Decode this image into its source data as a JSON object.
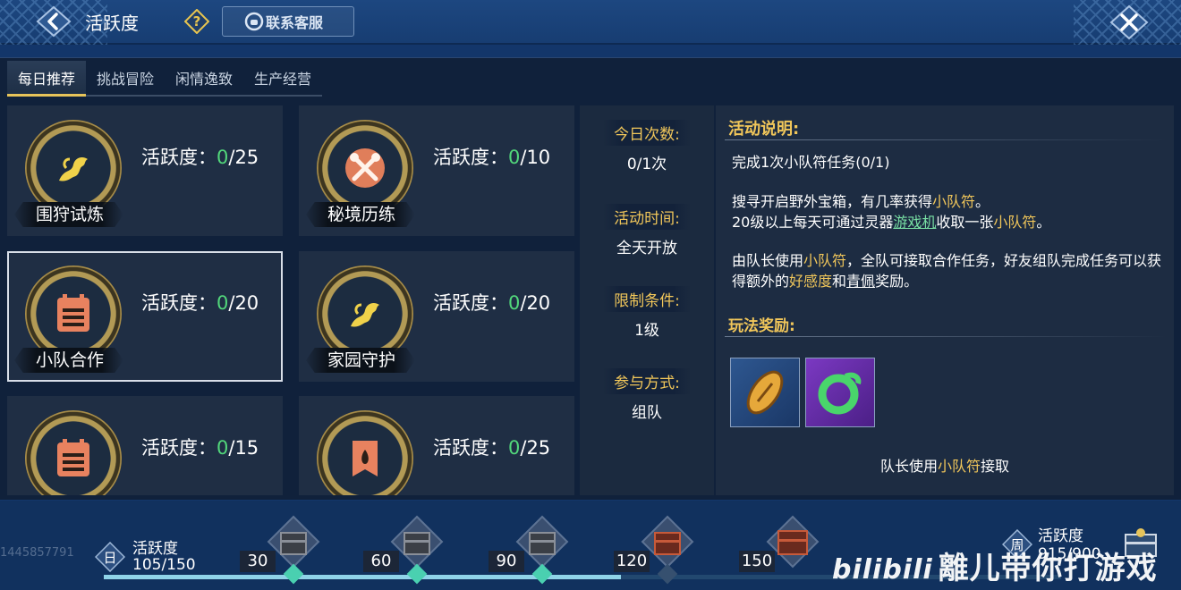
{
  "header": {
    "title": "活跃度",
    "customer_service": "联系客服"
  },
  "tabs": [
    {
      "label": "每日推荐",
      "active": true
    },
    {
      "label": "挑战冒险",
      "active": false
    },
    {
      "label": "闲情逸致",
      "active": false
    },
    {
      "label": "生产经营",
      "active": false
    }
  ],
  "activity_label": "活跃度：",
  "cards": [
    {
      "name": "围狩试炼",
      "current": "0",
      "max": "/25",
      "icon": "creature-icon"
    },
    {
      "name": "秘境历练",
      "current": "0",
      "max": "/10",
      "icon": "crossed-tools-icon"
    },
    {
      "name": "小队合作",
      "current": "0",
      "max": "/20",
      "icon": "calendar-icon"
    },
    {
      "name": "家园守护",
      "current": "0",
      "max": "/20",
      "icon": "creature-icon"
    },
    {
      "name": "",
      "current": "0",
      "max": "/15",
      "icon": "calendar-icon"
    },
    {
      "name": "",
      "current": "0",
      "max": "/25",
      "icon": "banner-icon"
    }
  ],
  "info": {
    "today_count": {
      "label": "今日次数:",
      "value": "0/1次"
    },
    "activity_time": {
      "label": "活动时间:",
      "value": "全天开放"
    },
    "restriction": {
      "label": "限制条件:",
      "value": "1级"
    },
    "participation": {
      "label": "参与方式:",
      "value": "组队"
    }
  },
  "description": {
    "title": "活动说明:",
    "task": {
      "prefix": "完成1次",
      "highlight": "小队符任务",
      "suffix": "(0/1)"
    },
    "p1": {
      "a": "搜寻开启野外宝箱，有几率获得",
      "b": "小队符",
      "c": "。"
    },
    "p2": {
      "a": "20级以上每天可通过灵器",
      "b": "游戏机",
      "c": "收取一张",
      "d": "小队符",
      "e": "。"
    },
    "p3": {
      "a": "由队长使用",
      "b": "小队符",
      "c": "，全队可接取合作任务，好友组队完成任务可以获得额外的",
      "d": "好感度",
      "e": "和",
      "f": "青佩",
      "g": "奖励。"
    },
    "reward_title": "玩法奖励:",
    "reward_note": {
      "a": "队长使用",
      "b": "小队符",
      "c": "接取"
    }
  },
  "bottom": {
    "user_id": "1445857791",
    "daily_badge": "日",
    "daily_label": "活跃度",
    "daily_value": "105/150",
    "daily_progress": 0.54,
    "milestones": [
      "30",
      "60",
      "90",
      "120",
      "150"
    ],
    "weekly_badge": "周",
    "weekly_label": "活跃度",
    "weekly_value": "915/900",
    "watermark_logo": "bilibili",
    "watermark_text": "離儿带你打游戏"
  }
}
